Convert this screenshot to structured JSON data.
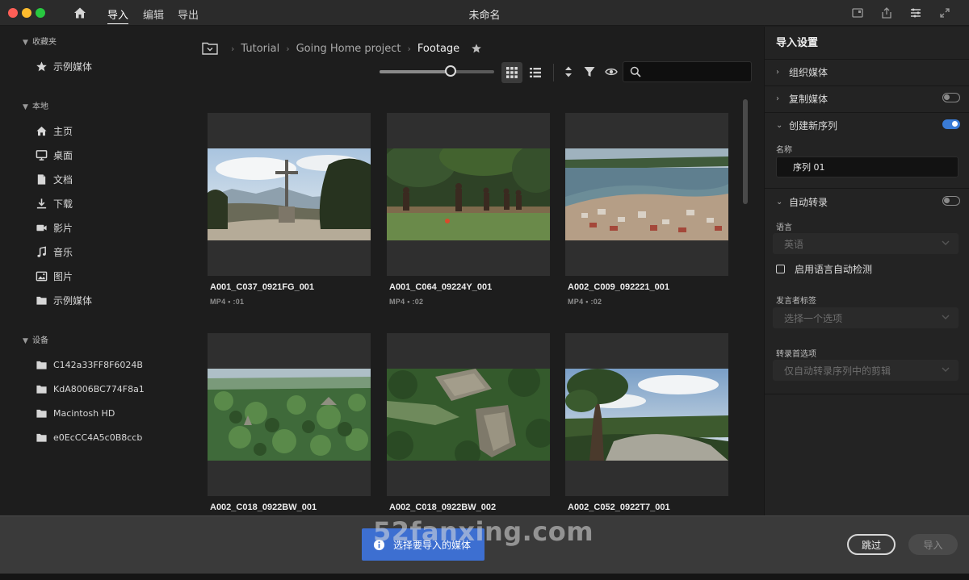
{
  "window": {
    "title": "未命名"
  },
  "menu": {
    "import": "导入",
    "edit": "编辑",
    "export": "导出"
  },
  "sidebar": {
    "favorites": {
      "heading": "收藏夹",
      "items": [
        {
          "label": "示例媒体",
          "icon": "star-icon"
        }
      ]
    },
    "local": {
      "heading": "本地",
      "items": [
        {
          "label": "主页",
          "icon": "home-icon"
        },
        {
          "label": "桌面",
          "icon": "desktop-icon"
        },
        {
          "label": "文档",
          "icon": "document-icon"
        },
        {
          "label": "下载",
          "icon": "download-icon"
        },
        {
          "label": "影片",
          "icon": "video-icon"
        },
        {
          "label": "音乐",
          "icon": "music-icon"
        },
        {
          "label": "图片",
          "icon": "picture-icon"
        },
        {
          "label": "示例媒体",
          "icon": "folder-icon"
        }
      ]
    },
    "devices": {
      "heading": "设备",
      "items": [
        {
          "label": "C142a33FF8F6024B",
          "icon": "folder-icon"
        },
        {
          "label": "KdA8006BC774F8a1",
          "icon": "folder-icon"
        },
        {
          "label": "Macintosh HD",
          "icon": "folder-icon"
        },
        {
          "label": "e0EcCC4A5c0B8ccb",
          "icon": "folder-icon"
        }
      ]
    }
  },
  "breadcrumb": {
    "items": [
      "Tutorial",
      "Going Home project"
    ],
    "current": "Footage"
  },
  "search": {
    "value": ""
  },
  "media": [
    {
      "name": "A001_C037_0921FG_001",
      "meta": "MP4 • :01",
      "scene": "cross"
    },
    {
      "name": "A001_C064_09224Y_001",
      "meta": "MP4 • :02",
      "scene": "soccer"
    },
    {
      "name": "A002_C009_092221_001",
      "meta": "MP4 • :02",
      "scene": "island"
    },
    {
      "name": "A002_C018_0922BW_001",
      "meta": "",
      "scene": "jungle"
    },
    {
      "name": "A002_C018_0922BW_002",
      "meta": "",
      "scene": "temple"
    },
    {
      "name": "A002_C052_0922T7_001",
      "meta": "",
      "scene": "tree"
    }
  ],
  "import_settings": {
    "title": "导入设置",
    "organize_media": "组织媒体",
    "copy_media": "复制媒体",
    "copy_media_enabled": false,
    "create_sequence": "创建新序列",
    "create_sequence_enabled": true,
    "name_label": "名称",
    "sequence_name": "序列 01",
    "auto_transcribe": "自动转录",
    "auto_transcribe_enabled": false,
    "language_label": "语言",
    "language_value": "英语",
    "auto_detect_label": "启用语言自动检测",
    "speaker_label": "发言者标签",
    "speaker_value": "选择一个选项",
    "transcribe_pref_label": "转录首选项",
    "transcribe_pref_value": "仅自动转录序列中的剪辑"
  },
  "footer": {
    "notice": "选择要导入的媒体",
    "skip": "跳过",
    "import": "导入",
    "watermark": "52fanxing.com"
  },
  "colors": {
    "accent": "#3a7bd5",
    "notice": "#3d6fd1",
    "background": "#1d1d1d"
  }
}
